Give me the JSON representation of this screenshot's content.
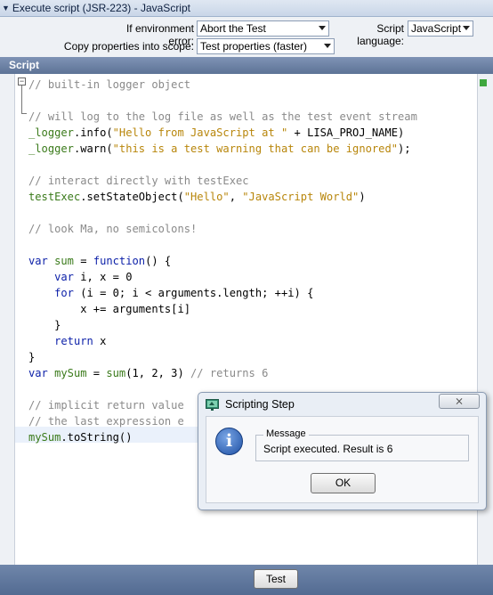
{
  "window": {
    "title": "Execute script (JSR-223) - JavaScript"
  },
  "properties": {
    "env_error_label": "If environment error:",
    "env_error_value": "Abort the Test",
    "script_language_label": "Script language:",
    "script_language_value": "JavaScript",
    "copy_props_label": "Copy properties into scope:",
    "copy_props_value": "Test properties (faster)"
  },
  "script_section": {
    "title": "Script"
  },
  "editor": {
    "fold_symbol": "−",
    "lines": [
      [
        [
          "cm",
          "// built-in logger object"
        ]
      ],
      [],
      [
        [
          "cm",
          "// will log to the log file as well as the test event stream"
        ]
      ],
      [
        [
          "vr",
          "_logger"
        ],
        [
          "df",
          ".info("
        ],
        [
          "st",
          "\"Hello from JavaScript at \""
        ],
        [
          "df",
          " + LISA_PROJ_NAME)"
        ]
      ],
      [
        [
          "vr",
          "_logger"
        ],
        [
          "df",
          ".warn("
        ],
        [
          "st",
          "\"this is a test warning that can be ignored\""
        ],
        [
          "df",
          ");"
        ]
      ],
      [],
      [
        [
          "cm",
          "// interact directly with testExec"
        ]
      ],
      [
        [
          "vr",
          "testExec"
        ],
        [
          "df",
          ".setStateObject("
        ],
        [
          "st",
          "\"Hello\""
        ],
        [
          "df",
          ", "
        ],
        [
          "st",
          "\"JavaScript World\""
        ],
        [
          "df",
          ")"
        ]
      ],
      [],
      [
        [
          "cm",
          "// look Ma, no semicolons!"
        ]
      ],
      [],
      [
        [
          "kw",
          "var "
        ],
        [
          "vr",
          "sum"
        ],
        [
          "df",
          " = "
        ],
        [
          "kw",
          "function"
        ],
        [
          "df",
          "() {"
        ]
      ],
      [
        [
          "df",
          "    "
        ],
        [
          "kw",
          "var "
        ],
        [
          "df",
          "i, x = 0"
        ]
      ],
      [
        [
          "df",
          "    "
        ],
        [
          "kw",
          "for"
        ],
        [
          "df",
          " (i = 0; i < arguments.length; ++i) {"
        ]
      ],
      [
        [
          "df",
          "        x += arguments[i]"
        ]
      ],
      [
        [
          "df",
          "    }"
        ]
      ],
      [
        [
          "df",
          "    "
        ],
        [
          "kw",
          "return"
        ],
        [
          "df",
          " x"
        ]
      ],
      [
        [
          "df",
          "}"
        ]
      ],
      [
        [
          "kw",
          "var "
        ],
        [
          "vr",
          "mySum"
        ],
        [
          "df",
          " = "
        ],
        [
          "vr",
          "sum"
        ],
        [
          "df",
          "(1, 2, 3) "
        ],
        [
          "cm",
          "// returns 6"
        ]
      ],
      [],
      [
        [
          "cm",
          "// implicit return value"
        ]
      ],
      [
        [
          "cm",
          "// the last expression e"
        ]
      ],
      [
        [
          "vr",
          "mySum"
        ],
        [
          "df",
          ".toString()"
        ]
      ]
    ]
  },
  "dialog": {
    "title": "Scripting Step",
    "close_glyph": "⨯",
    "message_legend": "Message",
    "message_text": "Script executed. Result is 6",
    "ok_label": "OK"
  },
  "footer": {
    "test_label": "Test"
  },
  "icons": {
    "collapse": "triangle-down-icon",
    "dialog": "scripting-step-icon",
    "info": "info-icon"
  }
}
